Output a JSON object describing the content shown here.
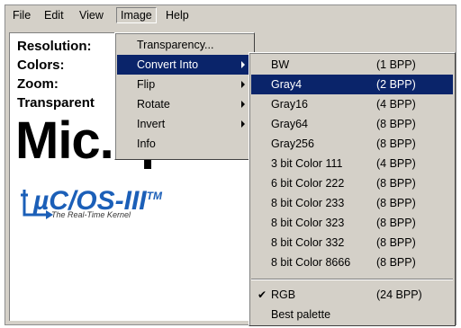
{
  "menubar": {
    "items": [
      {
        "label": "File"
      },
      {
        "label": "Edit"
      },
      {
        "label": "View"
      },
      {
        "label": "Image"
      },
      {
        "label": "Help"
      }
    ]
  },
  "info": {
    "resolution_label": "Resolution:",
    "colors_label": "Colors:",
    "zoom_label": "Zoom:",
    "transparent_label": "Transparent",
    "big_text": "Mic...p..."
  },
  "logo": {
    "name": "µC/OS-III",
    "tm": "TM",
    "tagline": "The Real-Time Kernel",
    "color": "#1b5fb8"
  },
  "image_menu": {
    "items": [
      {
        "label": "Transparency..."
      },
      {
        "label": "Convert Into",
        "highlighted": true,
        "submenu": true
      },
      {
        "label": "Flip",
        "submenu": true
      },
      {
        "label": "Rotate",
        "submenu": true
      },
      {
        "label": "Invert",
        "submenu": true
      },
      {
        "label": "Info"
      }
    ]
  },
  "convert_menu": {
    "items": [
      {
        "label": "BW",
        "bpp": "(1 BPP)"
      },
      {
        "label": "Gray4",
        "bpp": "(2 BPP)",
        "highlighted": true
      },
      {
        "label": "Gray16",
        "bpp": "(4 BPP)"
      },
      {
        "label": "Gray64",
        "bpp": "(8 BPP)"
      },
      {
        "label": "Gray256",
        "bpp": "(8 BPP)"
      },
      {
        "label": "3 bit Color 111",
        "bpp": "(4 BPP)"
      },
      {
        "label": "6 bit Color 222",
        "bpp": "(8 BPP)"
      },
      {
        "label": "8 bit Color 233",
        "bpp": "(8 BPP)"
      },
      {
        "label": "8 bit Color 323",
        "bpp": "(8 BPP)"
      },
      {
        "label": "8 bit Color 332",
        "bpp": "(8 BPP)"
      },
      {
        "label": "8 bit Color 8666",
        "bpp": "(8 BPP)"
      }
    ],
    "extra_items": [
      {
        "label": "RGB",
        "bpp": "(24 BPP)",
        "checked": true,
        "check_glyph": "✔"
      },
      {
        "label": "Best palette",
        "bpp": ""
      }
    ]
  },
  "colors": {
    "highlight": "#0a246a",
    "menu_bg": "#d4d0c8"
  }
}
